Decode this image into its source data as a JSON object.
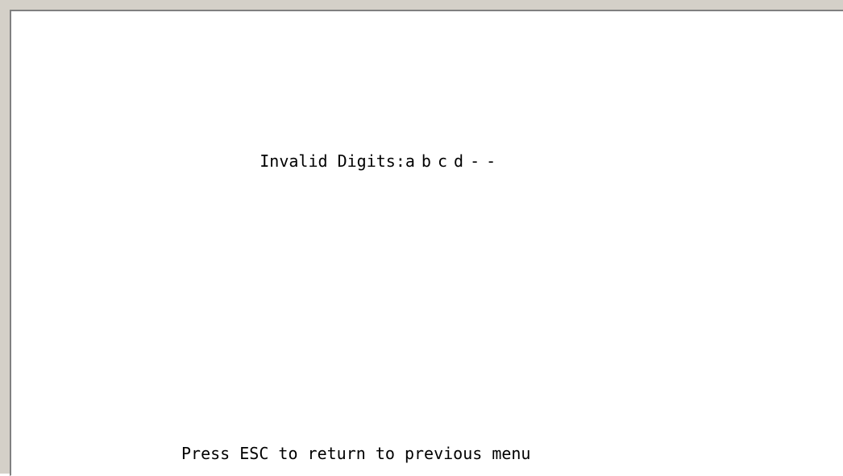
{
  "screen": {
    "invalid_digits": {
      "label": "Invalid Digits:",
      "values": [
        "a",
        "b",
        "c",
        "d",
        "-",
        "-"
      ]
    },
    "footer": {
      "text": "Press ESC to return to previous menu"
    }
  }
}
